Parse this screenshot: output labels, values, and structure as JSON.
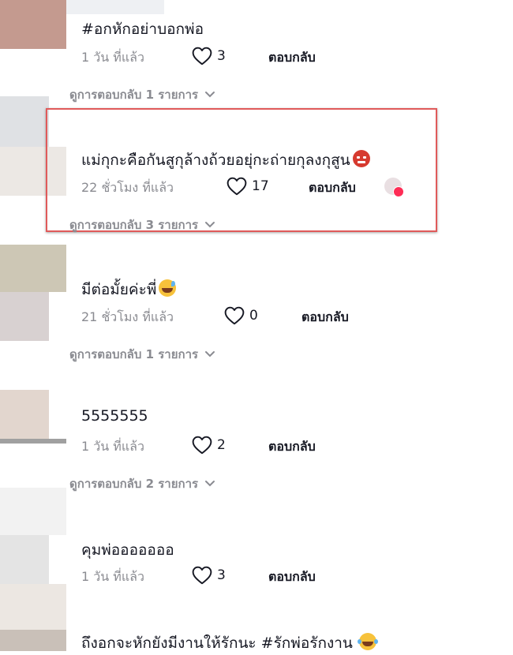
{
  "comments": [
    {
      "text": "#อกหักอย่าบอกพ่อ",
      "time": "1 วัน ที่แล้ว",
      "likes": "3",
      "reply": "ตอบกลับ",
      "view_replies": "ดูการตอบกลับ 1 รายการ"
    },
    {
      "text": "แม่กุกะคือกันสูกุล้างถ้วยอยุ่กะถ่ายกุลงกุสูน",
      "time": "22 ชั่วโมง ที่แล้ว",
      "likes": "17",
      "reply": "ตอบกลับ",
      "view_replies": "ดูการตอบกลับ 3 รายการ"
    },
    {
      "text": "มีต่อมั้ยค่ะพี่",
      "time": "21 ชั่วโมง ที่แล้ว",
      "likes": "0",
      "reply": "ตอบกลับ",
      "view_replies": "ดูการตอบกลับ 1 รายการ"
    },
    {
      "text": "5555555",
      "time": "1 วัน ที่แล้ว",
      "likes": "2",
      "reply": "ตอบกลับ",
      "view_replies": "ดูการตอบกลับ 2 รายการ"
    },
    {
      "text": "คุมพ่อออออออ",
      "time": "1 วัน ที่แล้ว",
      "likes": "3",
      "reply": "ตอบกลับ"
    },
    {
      "text": "ถึงอกจะหักยังมีงานให้รักนะ #รักพ่อรักงาน"
    }
  ],
  "colors": {
    "highlight_border": "#e05a5a",
    "meta_text": "#8a8b91",
    "creator_like_badge": "#fe2c55"
  },
  "icons": {
    "like": "heart-outline-icon",
    "expand": "chevron-down-icon"
  }
}
